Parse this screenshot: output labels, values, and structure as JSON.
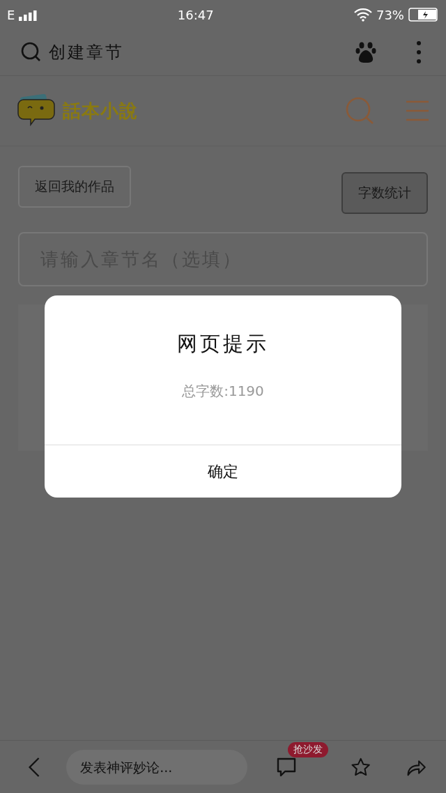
{
  "status_bar": {
    "network": "E",
    "time": "16:47",
    "battery": "73%"
  },
  "browser_bar": {
    "title": "创建章节"
  },
  "site_header": {
    "logo_text": "話本小說"
  },
  "actions": {
    "back_button": "返回我的作品",
    "count_button": "字数统计"
  },
  "chapter_name": {
    "placeholder": "请输入章节名（选填）"
  },
  "dialog": {
    "title": "网页提示",
    "message": "总字数:1190",
    "button": "确定"
  },
  "bottom_bar": {
    "comment_placeholder": "发表神评妙论...",
    "badge": "抢沙发"
  }
}
